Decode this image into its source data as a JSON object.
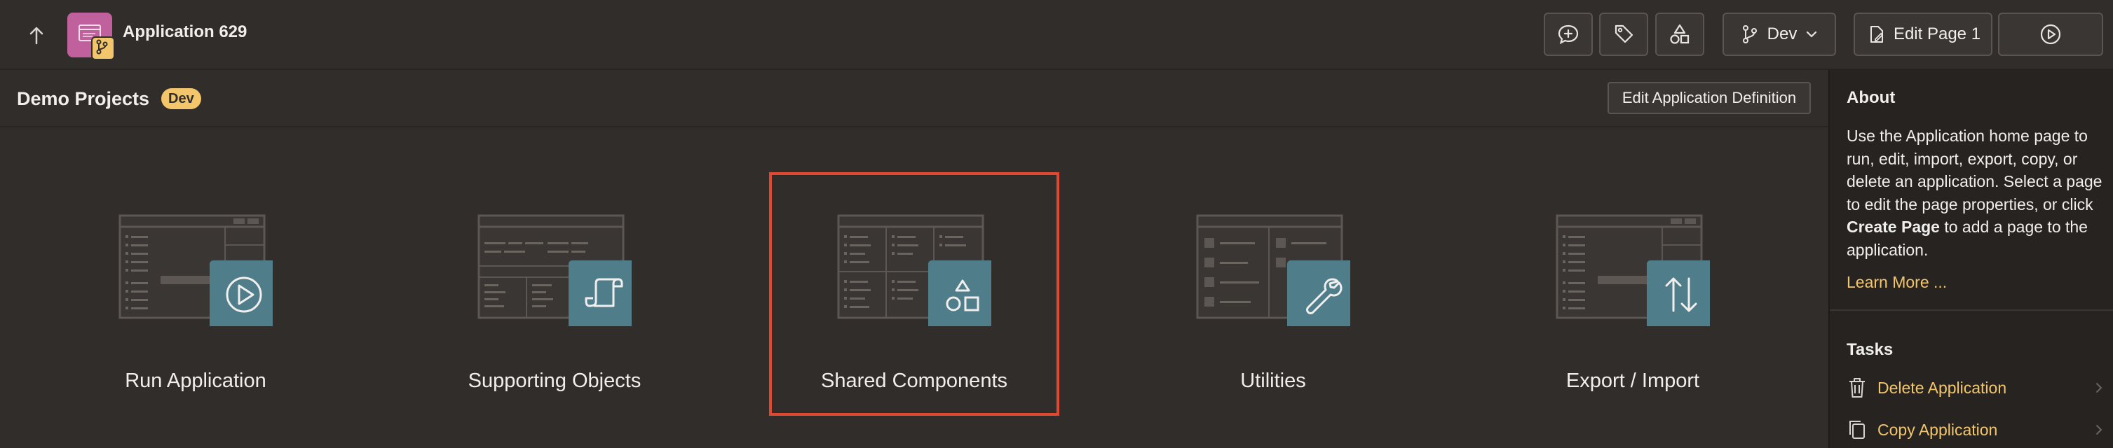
{
  "header": {
    "app_title": "Application 629",
    "branch_label": "Dev",
    "edit_page_label": "Edit Page 1"
  },
  "subheader": {
    "title": "Demo Projects",
    "badge": "Dev",
    "edit_definition_label": "Edit Application Definition"
  },
  "tiles": [
    {
      "label": "Run Application",
      "icon": "play-icon",
      "selected": false
    },
    {
      "label": "Supporting Objects",
      "icon": "scroll-icon",
      "selected": false
    },
    {
      "label": "Shared Components",
      "icon": "shapes-icon",
      "selected": true
    },
    {
      "label": "Utilities",
      "icon": "wrench-icon",
      "selected": false
    },
    {
      "label": "Export / Import",
      "icon": "arrows-up-down-icon",
      "selected": false
    }
  ],
  "about": {
    "heading": "About",
    "text_part1": "Use the Application home page to run, edit, import, export, copy, or delete an application. Select a page to edit the page properties, or click ",
    "text_bold": "Create Page",
    "text_part2": " to add a page to the application.",
    "learn_more": "Learn More ..."
  },
  "tasks": {
    "heading": "Tasks",
    "items": [
      {
        "label": "Delete Application",
        "icon": "trash-icon"
      },
      {
        "label": "Copy Application",
        "icon": "copy-icon"
      }
    ]
  },
  "colors": {
    "background": "#312d2a",
    "accent_gold": "#f3c66c",
    "selection_border": "#e2482f",
    "tile_icon_bg": "#4f7d8a",
    "app_icon_bg": "#c0619e"
  }
}
